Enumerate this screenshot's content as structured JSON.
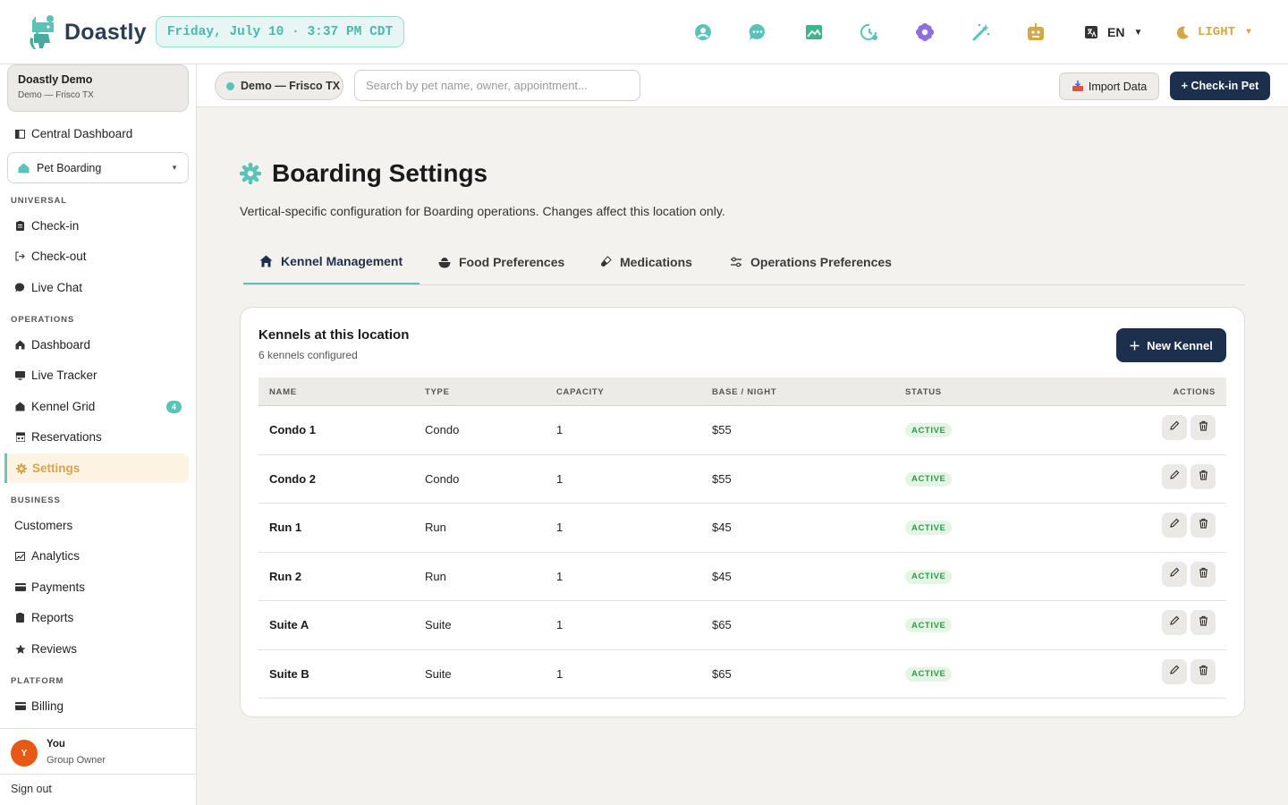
{
  "app": {
    "name": "Doastly"
  },
  "topbar": {
    "datetime": "Friday, July 10 · 3:37 PM CDT",
    "icons": [
      "profile-icon",
      "chat-icon",
      "image-icon",
      "history-icon",
      "flower-icon",
      "magic-wand-icon",
      "robot-icon"
    ],
    "language": "EN",
    "theme": "LIGHT",
    "theme_color": "#d3a84a"
  },
  "sidebar": {
    "org_name": "Doastly Demo",
    "org_location": "Demo — Frisco TX",
    "central_dashboard": "Central Dashboard",
    "vertical": "Pet Boarding",
    "sections": {
      "universal": "UNIVERSAL",
      "operations": "OPERATIONS",
      "business": "BUSINESS",
      "platform": "PLATFORM"
    },
    "universal_items": [
      "Check-in",
      "Check-out",
      "Live Chat"
    ],
    "operations_items": [
      "Dashboard",
      "Live Tracker",
      "Kennel Grid",
      "Reservations",
      "Settings"
    ],
    "kennel_grid_badge": "4",
    "business_items": [
      "Customers",
      "Analytics",
      "Payments",
      "Reports",
      "Reviews"
    ],
    "platform_items": [
      "Billing"
    ],
    "active_item": "Settings",
    "user": {
      "initial": "Y",
      "name": "You",
      "role": "Group Owner"
    },
    "sign_out": "Sign out"
  },
  "subheader": {
    "location": "Demo — Frisco TX",
    "search_placeholder": "Search by pet name, owner, appointment...",
    "import_label": "Import Data",
    "checkin_label": "+ Check-in Pet"
  },
  "main": {
    "title": "Boarding Settings",
    "description": "Vertical-specific configuration for Boarding operations. Changes affect this location only.",
    "tabs": [
      {
        "label": "Kennel Management",
        "icon": "home-icon"
      },
      {
        "label": "Food Preferences",
        "icon": "bowl-icon"
      },
      {
        "label": "Medications",
        "icon": "pill-icon"
      },
      {
        "label": "Operations Preferences",
        "icon": "sliders-icon"
      }
    ],
    "active_tab": "Kennel Management",
    "card": {
      "title": "Kennels at this location",
      "subtitle": "6 kennels configured",
      "new_button": "New Kennel",
      "columns": [
        "NAME",
        "TYPE",
        "CAPACITY",
        "BASE / NIGHT",
        "STATUS",
        "ACTIONS"
      ],
      "rows": [
        {
          "name": "Condo 1",
          "type": "Condo",
          "capacity": "1",
          "base": "$55",
          "status": "ACTIVE"
        },
        {
          "name": "Condo 2",
          "type": "Condo",
          "capacity": "1",
          "base": "$55",
          "status": "ACTIVE"
        },
        {
          "name": "Run 1",
          "type": "Run",
          "capacity": "1",
          "base": "$45",
          "status": "ACTIVE"
        },
        {
          "name": "Run 2",
          "type": "Run",
          "capacity": "1",
          "base": "$45",
          "status": "ACTIVE"
        },
        {
          "name": "Suite A",
          "type": "Suite",
          "capacity": "1",
          "base": "$65",
          "status": "ACTIVE"
        },
        {
          "name": "Suite B",
          "type": "Suite",
          "capacity": "1",
          "base": "$65",
          "status": "ACTIVE"
        }
      ]
    }
  },
  "colors": {
    "accent_teal": "#5bc2b8",
    "navy": "#1c2f4c",
    "active_bg": "#fdf3e2",
    "active_text": "#d8a24a",
    "status_green": "#2f9a45"
  }
}
